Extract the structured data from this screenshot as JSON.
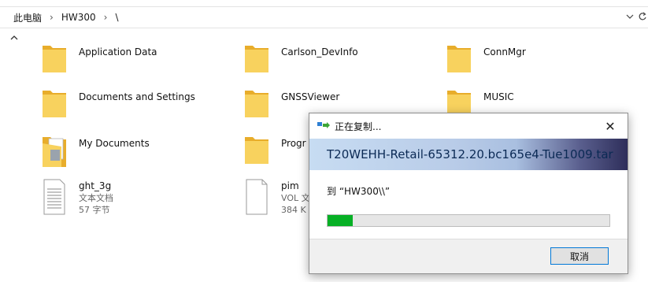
{
  "breadcrumb": {
    "items": [
      "此电脑",
      "HW300",
      "\\"
    ],
    "separator": "›"
  },
  "files": [
    {
      "name": "Application Data",
      "type": "folder"
    },
    {
      "name": "Carlson_DevInfo",
      "type": "folder"
    },
    {
      "name": "ConnMgr",
      "type": "folder"
    },
    {
      "name": "Documents and Settings",
      "type": "folder"
    },
    {
      "name": "GNSSViewer",
      "type": "folder"
    },
    {
      "name": "MUSIC",
      "type": "folder"
    },
    {
      "name": "My Documents",
      "type": "folder-docs"
    },
    {
      "name": "Progr",
      "type": "folder"
    },
    {
      "name": "ght_3g",
      "type": "text-file",
      "kind": "文本文档",
      "size": "57 字节"
    },
    {
      "name": "pim",
      "type": "file",
      "kind": "VOL 文",
      "size": "384 K"
    }
  ],
  "dialog": {
    "title": "正在复制...",
    "filename": "T20WEHH-Retail-65312.20.bc165e4-Tue1009.tar",
    "destination": "到 “HW300\\\\”",
    "progress_percent": 9,
    "cancel_label": "取消",
    "close_glyph": "✕"
  },
  "colors": {
    "folder": "#f5c542",
    "progress": "#06b025",
    "accent": "#0078d7"
  }
}
